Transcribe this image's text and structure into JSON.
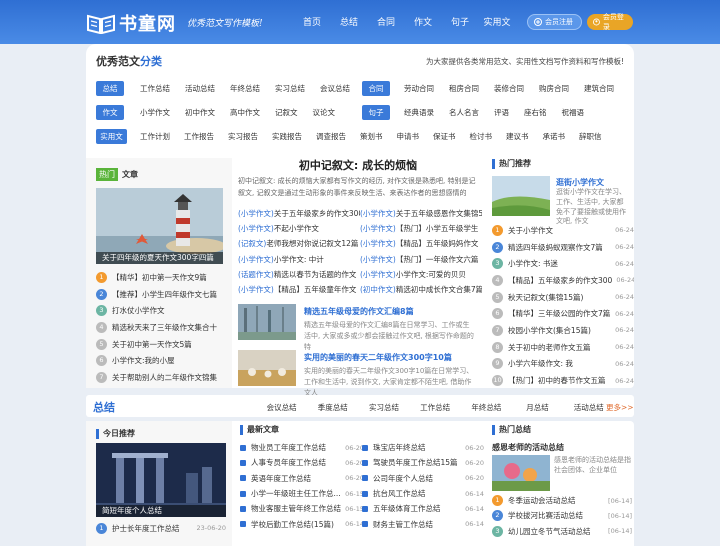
{
  "header": {
    "logo_text": "书童网",
    "slogan": "优秀范文写作模板!",
    "nav": [
      "首页",
      "总结",
      "合同",
      "作文",
      "句子",
      "实用文"
    ],
    "register_label": "会员注册",
    "login_label": "会员登录"
  },
  "category": {
    "title_plain": "优秀范文",
    "title_accent": "分类",
    "desc": "为大家提供各类常用范文、实用性文档写作资料和写作模板!",
    "rows": [
      {
        "tag": "总结",
        "links": [
          "工作总结",
          "活动总结",
          "年终总结",
          "实习总结",
          "会议总结"
        ]
      },
      {
        "tag": "合同",
        "links": [
          "劳动合同",
          "租房合同",
          "装修合同",
          "购房合同",
          "建筑合同"
        ]
      },
      {
        "tag": "作文",
        "links": [
          "小学作文",
          "初中作文",
          "高中作文",
          "记叙文",
          "议论文"
        ]
      },
      {
        "tag": "句子",
        "links": [
          "经典语录",
          "名人名言",
          "评语",
          "座右铭",
          "祝福语"
        ]
      },
      {
        "tag": "实用文",
        "links": [
          "工作计划",
          "工作报告",
          "实习报告",
          "实践报告",
          "调查报告",
          "策划书",
          "申请书",
          "保证书",
          "检讨书",
          "建议书",
          "承诺书",
          "辞职信"
        ]
      }
    ]
  },
  "hot_articles": {
    "label_tag": "热门",
    "label": "文章",
    "image_caption": "关于四年级的夏天作文300字四篇",
    "items": [
      "【精华】初中第一天作文9篇",
      "【推荐】小学生四年级作文七篇",
      "打水仗小学作文",
      "精选秋天来了三年级作文集合十",
      "关于初中第一天作文5篇",
      "小学作文:我的小屋",
      "关于帮助别人的二年级作文锦集"
    ]
  },
  "featured": {
    "title": "初中记叙文: 成长的烦恼",
    "summary": "初中记叙文: 成长的烦恼大家都有写作文的经历, 对作文很是熟悉吧, 特别是记叙文, 记叙文是通过生动形象的事件来反映生活、来表达作者的思想感情的",
    "list": [
      [
        "(小学作文)",
        "关于五年级家乡的作文300",
        "(小学作文)",
        "关于五年级感恩作文集锦5"
      ],
      [
        "(小学作文)",
        "不起小学作文",
        "(小学作文)",
        "【热门】小学五年级学生"
      ],
      [
        "(记叙文)",
        "老师我想对你说记叙文12篇",
        "(小学作文)",
        "【精品】五年级妈妈作文"
      ],
      [
        "(小学作文)",
        "小学作文: 中计",
        "(小学作文)",
        "【热门】一年级作文六篇"
      ],
      [
        "(话题作文)",
        "精选以春节为话题的作文",
        "(小学作文)",
        "小学作文:可爱的贝贝"
      ],
      [
        "(小学作文)",
        "【精品】五年级童年作文",
        "(初中作文)",
        "精选初中成长作文合集7篇"
      ]
    ],
    "articles": [
      {
        "title": "精选五年级母爱的作文汇编8篇",
        "body": "精选五年级母爱的作文汇编8篇在日常学习、工作或生活中, 大家或多或少都会接触过作文吧, 根据写作命题的特"
      },
      {
        "title": "实用的美丽的春天二年级作文300字10篇",
        "body": "实用的美丽的春天二年级作文300字10篇在日常学习、工作和生活中, 说到作文, 大家肯定都不陌生吧, 借助作文人"
      }
    ]
  },
  "recommend": {
    "head": "热门推荐",
    "top_title": "逛街小学作文",
    "top_body": "逛街小学作文在学习、工作、生活中, 大家都免不了要接触或使用作文吧, 作文",
    "items": [
      {
        "t": "关于小学作文",
        "d": "06-24"
      },
      {
        "t": "精选四年级蚂蚁观察作文7篇",
        "d": "06-24"
      },
      {
        "t": "小学作文: 书迷",
        "d": "06-24"
      },
      {
        "t": "【精品】五年级家乡的作文300",
        "d": "06-24"
      },
      {
        "t": "秋天记叙文(集锦15篇)",
        "d": "06-24"
      },
      {
        "t": "【精华】三年级公园的作文7篇",
        "d": "06-24"
      },
      {
        "t": "校园小学作文(集合15篇)",
        "d": "06-24"
      },
      {
        "t": "关于初中的老师作文五篇",
        "d": "06-24"
      },
      {
        "t": "小学六年级作文: 我",
        "d": "06-24"
      },
      {
        "t": "【热门】初中的春节作文五篇",
        "d": "06-24"
      }
    ]
  },
  "summary_section": {
    "title": "总结",
    "links": [
      "会议总结",
      "季度总结",
      "实习总结",
      "工作总结",
      "年终总结",
      "月总结",
      "活动总结"
    ],
    "more": "更多>>",
    "today_head": "今日推荐",
    "today_caption": "简短年度个人总结",
    "today_item": {
      "t": "护士长年度工作总结",
      "d": "23-06-20"
    },
    "latest_head": "最新文章",
    "latest": [
      {
        "t": "物业员工年度工作总结",
        "d": "06-20",
        "t2": "珠宝店年终总结",
        "d2": "06-20"
      },
      {
        "t": "人事专员年度工作总结",
        "d": "06-20",
        "t2": "驾驶员年度工作总结15篇",
        "d2": "06-20"
      },
      {
        "t": "英语年度工作总结",
        "d": "06-20",
        "t2": "公司年度个人总结",
        "d2": "06-20"
      },
      {
        "t": "小学一年级班主任工作总...",
        "d": "06-15",
        "t2": "抗台风工作总结",
        "d2": "06-14"
      },
      {
        "t": "物业客服主管年终工作总结",
        "d": "06-15",
        "t2": "五年级体育工作总结",
        "d2": "06-14"
      },
      {
        "t": "学校后勤工作总结(15篇)",
        "d": "06-14",
        "t2": "财务主管工作总结",
        "d2": "06-14"
      }
    ],
    "hot_head": "热门总结",
    "hot_top_title": "感恩老师的活动总结",
    "hot_top_body": "感恩老师的活动总结是指社会团体、企业单位",
    "hot_items": [
      {
        "t": "冬季运动会活动总结",
        "d": "[06-14]"
      },
      {
        "t": "学校拔河比赛活动总结",
        "d": "[06-14]"
      },
      {
        "t": "幼儿园立冬节气活动总结",
        "d": "[06-14]"
      }
    ]
  }
}
